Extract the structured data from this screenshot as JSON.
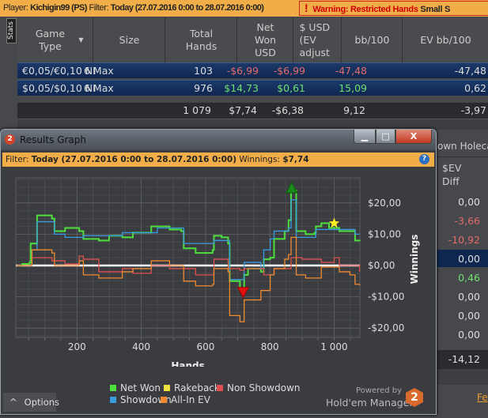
{
  "topbar": {
    "player_label": "Player:",
    "player": "Kichigin99 (PS)",
    "filter_label": "Filter:",
    "filter": "Today (27.07.2016 0:00 to 28.07.2016 0:00)",
    "warning_mark": "!",
    "warning": "Warning: Restricted Hands",
    "warning_tail": "Small S"
  },
  "stats_tab": "Stats",
  "table": {
    "headers": [
      "Game Type",
      "Size",
      "Total Hands",
      "Net Won USD",
      "$ USD (EV adjust",
      "bb/100",
      "EV bb/100"
    ],
    "rows": [
      {
        "game": "€0,05/€0,10 NI",
        "size": "6 Max",
        "hands": "103",
        "net": "-$6,99",
        "ev": "-$6,99",
        "bb": "-47,48",
        "evbb": "-47,48"
      },
      {
        "game": "$0,05/$0,10 NI",
        "size": "6 Max",
        "hands": "976",
        "net": "$14,73",
        "ev": "$0,61",
        "bb": "15,09",
        "evbb": "0,62"
      }
    ],
    "totals": {
      "hands": "1 079",
      "net": "$7,74",
      "ev": "-$6,38",
      "bb": "9,12",
      "evbb": "-3,97"
    }
  },
  "right_panel": {
    "header": "own Holeca",
    "col": "$EV Diff",
    "values": [
      "0,00",
      "-3,66",
      "-10,92",
      "0,00",
      "0,46",
      "0,00",
      "0,00",
      "0,00"
    ],
    "total": "-14,12",
    "link": "Fe"
  },
  "window": {
    "icon": "2",
    "title": "Results Graph",
    "min": "▁",
    "max": "□",
    "close": "X"
  },
  "filterbar": {
    "label": "Filter:",
    "value": "Today (27.07.2016 0:00 to 28.07.2016 0:00)",
    "win_label": "Winnings:",
    "win_value": "$7,74",
    "help": "?"
  },
  "options": {
    "caret": "^",
    "label": "Options"
  },
  "branding": {
    "powered": "Powered by",
    "name": "Hold'em Manager",
    "logo": "2"
  },
  "colors": {
    "net_won": "#4ddf3c",
    "rakeback": "#f0e040",
    "non_showdown": "#e05050",
    "showdown": "#3a9ae0",
    "allin_ev": "#f08a30"
  },
  "chart_data": {
    "type": "line",
    "xlabel": "Hands",
    "ylabel": "Winnings",
    "xlim": [
      10,
      1080
    ],
    "ylim": [
      -23,
      28
    ],
    "xticks": [
      200,
      400,
      600,
      800,
      1000
    ],
    "xtick_labels": [
      "200",
      "400",
      "600",
      "800",
      "1 000"
    ],
    "yticks": [
      20,
      10,
      0,
      -10,
      -20
    ],
    "ytick_labels": [
      "$20,00",
      "$10,00",
      "$0,00",
      "-$10,00",
      "-$20,00"
    ],
    "legend": [
      "Net Won",
      "Rakeback",
      "Non Showdown",
      "Showdown",
      "All-In EV"
    ],
    "legend_position": "bottom",
    "series": [
      {
        "name": "Net Won",
        "key": "net_won",
        "points": [
          [
            12,
            0
          ],
          [
            30,
            0.5
          ],
          [
            53,
            1
          ],
          [
            56,
            7
          ],
          [
            72,
            7
          ],
          [
            76,
            16
          ],
          [
            122,
            15
          ],
          [
            130,
            11
          ],
          [
            163,
            12
          ],
          [
            207,
            11
          ],
          [
            220,
            8.5
          ],
          [
            268,
            8
          ],
          [
            300,
            9.5
          ],
          [
            341,
            9
          ],
          [
            374,
            10.5
          ],
          [
            431,
            12.5
          ],
          [
            488,
            11.5
          ],
          [
            524,
            11
          ],
          [
            532,
            5.5
          ],
          [
            569,
            4
          ],
          [
            622,
            5
          ],
          [
            626,
            9.5
          ],
          [
            650,
            9
          ],
          [
            670,
            7
          ],
          [
            675,
            -5
          ],
          [
            707,
            -7.5
          ],
          [
            720,
            -3
          ],
          [
            732,
            -1
          ],
          [
            772,
            -2
          ],
          [
            781,
            2
          ],
          [
            801,
            2.5
          ],
          [
            813,
            8.5
          ],
          [
            846,
            11
          ],
          [
            858,
            14.5
          ],
          [
            866,
            24
          ],
          [
            878,
            24
          ],
          [
            882,
            11
          ],
          [
            911,
            10
          ],
          [
            939,
            10.5
          ],
          [
            943,
            12.5
          ],
          [
            960,
            13.5
          ],
          [
            984,
            12
          ],
          [
            1016,
            11
          ],
          [
            1049,
            11
          ],
          [
            1065,
            8
          ],
          [
            1079,
            7.74
          ]
        ]
      },
      {
        "name": "Showdown",
        "key": "showdown",
        "points": [
          [
            12,
            0
          ],
          [
            60,
            5
          ],
          [
            76,
            14
          ],
          [
            122,
            14
          ],
          [
            130,
            10
          ],
          [
            163,
            9
          ],
          [
            220,
            9.5
          ],
          [
            300,
            9.5
          ],
          [
            341,
            10.5
          ],
          [
            431,
            10.5
          ],
          [
            450,
            12
          ],
          [
            524,
            12
          ],
          [
            532,
            7
          ],
          [
            622,
            7
          ],
          [
            626,
            8
          ],
          [
            670,
            8
          ],
          [
            675,
            -4.5
          ],
          [
            707,
            -4.5
          ],
          [
            720,
            1
          ],
          [
            760,
            1
          ],
          [
            772,
            -1
          ],
          [
            781,
            5
          ],
          [
            801,
            8.5
          ],
          [
            813,
            11
          ],
          [
            846,
            11
          ],
          [
            858,
            12
          ],
          [
            866,
            21
          ],
          [
            878,
            21
          ],
          [
            882,
            9
          ],
          [
            939,
            9
          ],
          [
            943,
            11.5
          ],
          [
            1049,
            11.5
          ],
          [
            1065,
            10
          ],
          [
            1079,
            10
          ]
        ]
      },
      {
        "name": "Non Showdown",
        "key": "non_showdown",
        "points": [
          [
            12,
            0
          ],
          [
            60,
            2.5
          ],
          [
            122,
            1.5
          ],
          [
            163,
            0.5
          ],
          [
            207,
            3
          ],
          [
            220,
            2
          ],
          [
            268,
            -2
          ],
          [
            341,
            -1
          ],
          [
            374,
            -2.5
          ],
          [
            431,
            0
          ],
          [
            488,
            -1
          ],
          [
            569,
            -3
          ],
          [
            626,
            2
          ],
          [
            670,
            -1
          ],
          [
            707,
            -1.5
          ],
          [
            720,
            -1
          ],
          [
            781,
            -3
          ],
          [
            813,
            -1
          ],
          [
            866,
            2.5
          ],
          [
            900,
            2
          ],
          [
            960,
            1
          ],
          [
            1000,
            2.5
          ],
          [
            1016,
            0
          ],
          [
            1049,
            0
          ],
          [
            1079,
            -2
          ]
        ]
      },
      {
        "name": "All-In EV",
        "key": "allin_ev",
        "points": [
          [
            12,
            0
          ],
          [
            60,
            5
          ],
          [
            76,
            5
          ],
          [
            122,
            4
          ],
          [
            130,
            0
          ],
          [
            163,
            0
          ],
          [
            207,
            1.5
          ],
          [
            220,
            -3
          ],
          [
            268,
            -4
          ],
          [
            341,
            -2
          ],
          [
            374,
            -1
          ],
          [
            431,
            1.5
          ],
          [
            488,
            0
          ],
          [
            532,
            -5
          ],
          [
            569,
            -6.5
          ],
          [
            622,
            -6
          ],
          [
            626,
            -1
          ],
          [
            670,
            -2
          ],
          [
            675,
            -16
          ],
          [
            707,
            -18
          ],
          [
            720,
            -11
          ],
          [
            760,
            -11
          ],
          [
            772,
            -8
          ],
          [
            781,
            -8
          ],
          [
            801,
            -3
          ],
          [
            813,
            -1
          ],
          [
            846,
            2
          ],
          [
            858,
            3.5
          ],
          [
            866,
            9
          ],
          [
            878,
            9
          ],
          [
            882,
            -3
          ],
          [
            911,
            -4
          ],
          [
            960,
            -0.5
          ],
          [
            1016,
            -2
          ],
          [
            1049,
            -3
          ],
          [
            1065,
            -6
          ],
          [
            1079,
            -6.38
          ]
        ]
      }
    ],
    "markers": [
      {
        "type": "max",
        "hands": 868,
        "value": 25
      },
      {
        "type": "min",
        "hands": 717,
        "value": -8.5
      },
      {
        "type": "star",
        "hands": 1000,
        "value": 13.5
      }
    ]
  }
}
